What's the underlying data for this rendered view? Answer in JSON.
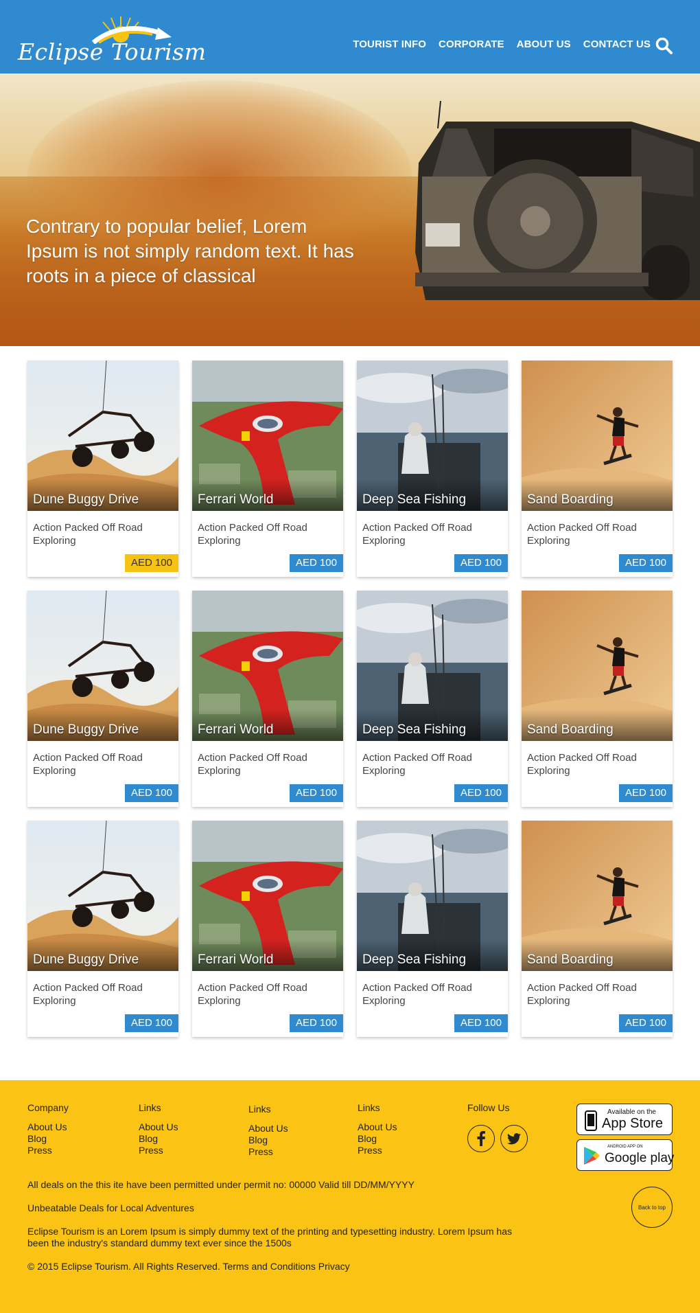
{
  "header": {
    "logo_text": "Eclipse Tourism",
    "nav": [
      "TOURIST INFO",
      "CORPORATE",
      "ABOUT US",
      "CONTACT US"
    ],
    "search_icon": "search-icon",
    "colors": {
      "bar": "#2f8ad0"
    }
  },
  "hero": {
    "text": "Contrary to popular belief, Lorem Ipsum is not simply random text. It has roots in a piece of classical"
  },
  "cards": [
    {
      "title": "Dune Buggy Drive",
      "desc": "Action Packed Off Road Exploring",
      "price": "AED 100",
      "highlight": true
    },
    {
      "title": "Ferrari World",
      "desc": "Action Packed Off Road Exploring",
      "price": "AED 100"
    },
    {
      "title": "Deep Sea Fishing",
      "desc": "Action Packed Off Road Exploring",
      "price": "AED 100"
    },
    {
      "title": "Sand Boarding",
      "desc": "Action Packed Off Road Exploring",
      "price": "AED 100"
    },
    {
      "title": "Dune Buggy Drive",
      "desc": "Action Packed Off Road Exploring",
      "price": "AED 100"
    },
    {
      "title": "Ferrari World",
      "desc": "Action Packed Off Road Exploring",
      "price": "AED 100"
    },
    {
      "title": "Deep Sea Fishing",
      "desc": "Action Packed Off Road Exploring",
      "price": "AED 100"
    },
    {
      "title": "Sand Boarding",
      "desc": "Action Packed Off Road Exploring",
      "price": "AED 100"
    },
    {
      "title": "Dune Buggy Drive",
      "desc": "Action Packed Off Road Exploring",
      "price": "AED 100"
    },
    {
      "title": "Ferrari World",
      "desc": "Action Packed Off Road Exploring",
      "price": "AED 100"
    },
    {
      "title": "Deep Sea Fishing",
      "desc": "Action Packed Off Road Exploring",
      "price": "AED 100"
    },
    {
      "title": "Sand Boarding",
      "desc": "Action Packed Off Road Exploring",
      "price": "AED 100"
    }
  ],
  "footer": {
    "columns": [
      {
        "head": "Company",
        "links": [
          "About Us",
          "Blog",
          "Press"
        ]
      },
      {
        "head": "Links",
        "links": [
          "About Us",
          "Blog",
          "Press"
        ]
      },
      {
        "head": "Links",
        "links": [
          "About Us",
          "Blog",
          "Press"
        ]
      },
      {
        "head": "Links",
        "links": [
          "About Us",
          "Blog",
          "Press"
        ]
      }
    ],
    "follow_us": "Follow Us",
    "app_store": {
      "small": "Available on the",
      "big": "App Store"
    },
    "google_play": {
      "small": "ANDROID APP ON",
      "big": "Google play"
    },
    "permit": "All deals on the this ite have been permitted under permit no: 00000 Valid till DD/MM/YYYY",
    "tagline": "Unbeatable Deals for Local Adventures",
    "about": "Eclipse Tourism is an Lorem Ipsum is simply dummy text of the printing and typesetting industry. Lorem Ipsum has been the industry's standard dummy text ever since the 1500s",
    "copyright": "© 2015 Eclipse Tourism. All Rights Reserved. Terms and Conditions Privacy",
    "back_to_top": "Back to top",
    "colors": {
      "background": "#fbc414"
    }
  }
}
